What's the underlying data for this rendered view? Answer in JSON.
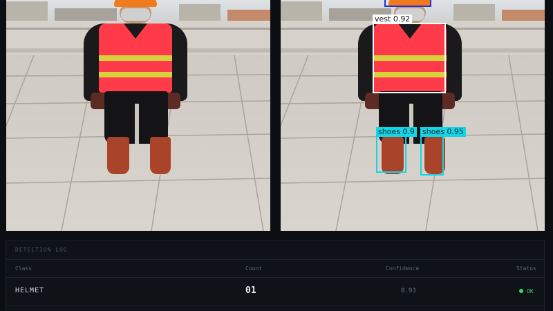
{
  "detections": [
    {
      "label": "vest 0.92"
    },
    {
      "label": "shoes 0.9"
    },
    {
      "label": "shoes 0.95"
    }
  ],
  "log": {
    "title": "DETECTION LOG",
    "columns": {
      "class": "Class",
      "count": "Count",
      "confidence": "Confidence",
      "status": "Status"
    },
    "rows": [
      {
        "class": "HELMET",
        "count": "01",
        "confidence": "0.93",
        "status": "OK"
      }
    ]
  },
  "colors": {
    "helmet_box": "#2233dd",
    "vest_box": "#ffffff",
    "shoe_box": "#15d4e6",
    "status_ok": "#2ee06a"
  }
}
